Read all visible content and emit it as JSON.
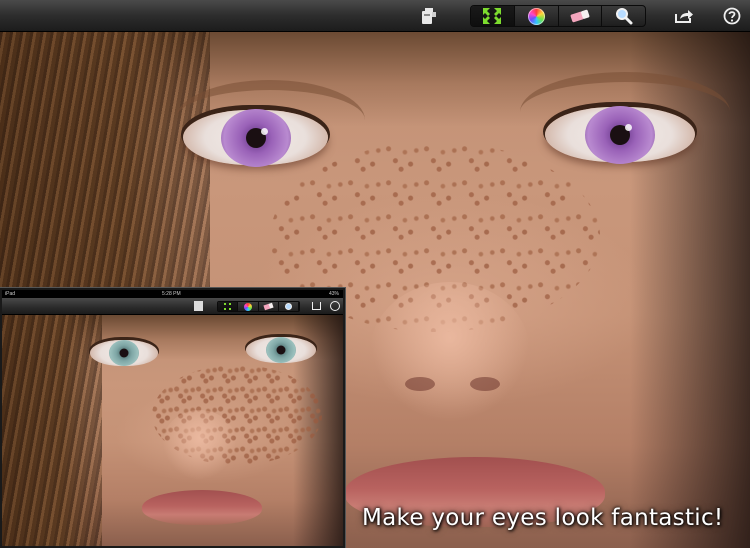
{
  "toolbar": {
    "left_icon": "paint-bucket-icon",
    "tools": [
      {
        "name": "fit-to-screen",
        "icon": "expand-arrows-icon",
        "active": true
      },
      {
        "name": "color",
        "icon": "color-wheel-icon",
        "active": false
      },
      {
        "name": "eraser",
        "icon": "eraser-icon",
        "active": false
      },
      {
        "name": "zoom",
        "icon": "magnifier-icon",
        "active": false
      }
    ],
    "share_icon": "share-icon",
    "help_icon": "help-icon"
  },
  "inset": {
    "status_bar": {
      "carrier": "iPad",
      "time": "5:28 PM",
      "battery": "43%"
    }
  },
  "caption": "Make your eyes look fantastic!",
  "colors": {
    "iris_after": "#9a62b8",
    "iris_before": "#7fa7a6",
    "active_tool": "#7ddc2e"
  }
}
